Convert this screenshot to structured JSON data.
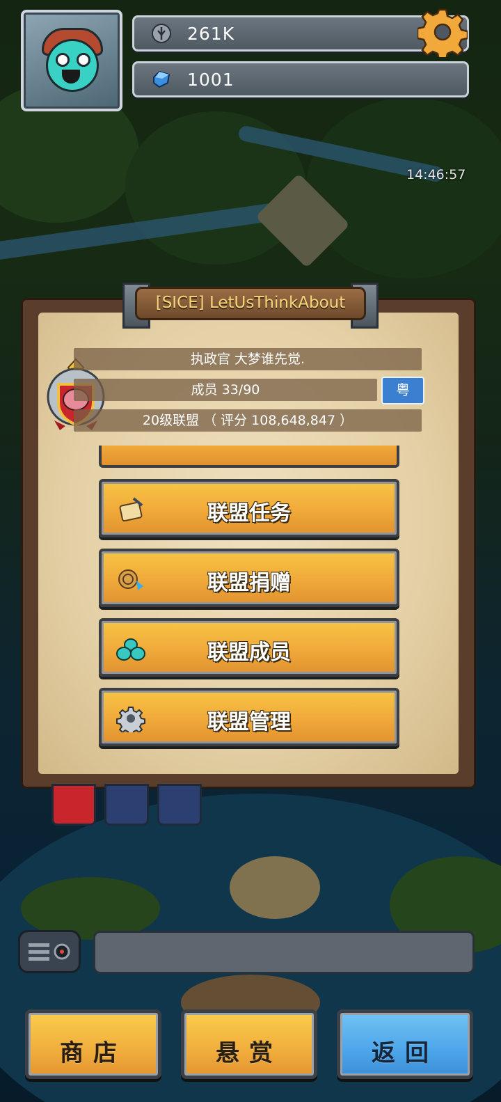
{
  "hud": {
    "silver_amount": "261K",
    "gem_amount": "1001",
    "timer": "14:46:57",
    "colors": {
      "accent_gold": "#f0a93a",
      "gem_blue": "#3b8fe0",
      "panel_wood": "#5a3d2a"
    }
  },
  "alliance": {
    "title": "[SICE] LetUsThinkAbout",
    "leader": "执政官 大梦谁先觉.",
    "members": "成员 33/90",
    "language_badge": "粤",
    "level_score": "20级联盟 （ 评分 108,648,847 ）"
  },
  "menu": [
    {
      "label": "联盟任务",
      "icon": "quest-scroll-icon"
    },
    {
      "label": "联盟捐赠",
      "icon": "donate-coins-icon"
    },
    {
      "label": "联盟成员",
      "icon": "members-slime-icon"
    },
    {
      "label": "联盟管理",
      "icon": "settings-gear-icon"
    }
  ],
  "bottom": {
    "shop": "商店",
    "bounty": "悬赏",
    "back": "返回"
  }
}
